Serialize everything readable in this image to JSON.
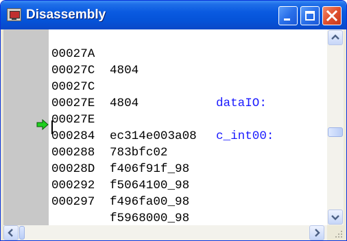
{
  "window": {
    "title": "Disassembly",
    "title_icon": "disassembly-window-icon",
    "buttons": [
      "minimize-icon",
      "maximize-icon",
      "close-icon"
    ]
  },
  "disassembly": {
    "current_line_marker": "green-arrow-icon",
    "lines": [
      {
        "address": "00027A",
        "code": "4804",
        "label": ""
      },
      {
        "address": "00027C",
        "code": "",
        "label": "dataIO:"
      },
      {
        "address": "00027C",
        "code": "4804",
        "label": ""
      },
      {
        "address": "00027E",
        "code": "",
        "label": "c_int00:"
      },
      {
        "address": "00027E",
        "code": "ec314e003a08",
        "label": ""
      },
      {
        "address": "000284",
        "code": "783bfc02",
        "label": ""
      },
      {
        "address": "000288",
        "code": "f406f91f_98",
        "label": ""
      },
      {
        "address": "00028D",
        "code": "f5064100_98",
        "label": ""
      },
      {
        "address": "000292",
        "code": "f496fa00_98",
        "label": ""
      },
      {
        "address": "000297",
        "code": "f5968000_98",
        "label": ""
      }
    ]
  },
  "colors": {
    "title_bar": "#0553d8",
    "label_text": "#1a1aff",
    "gutter": "#c8c8c8",
    "arrow": "#1fd01f"
  }
}
